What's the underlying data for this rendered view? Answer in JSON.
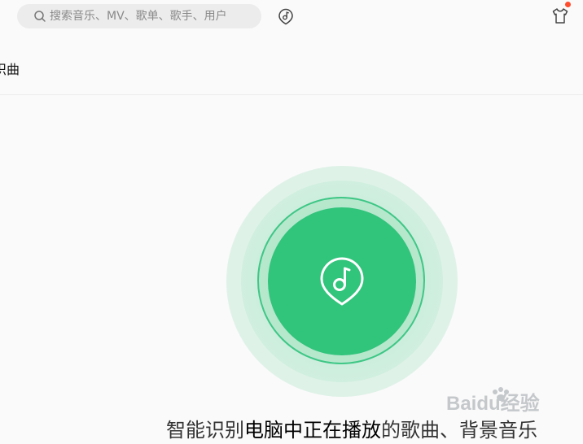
{
  "header": {
    "search_placeholder": "搜索音乐、MV、歌单、歌手、用户",
    "icons": {
      "search": "search-icon",
      "music_recognize": "music-note-icon",
      "skin": "tshirt-icon"
    },
    "has_notification": true
  },
  "tab": {
    "label": "识曲"
  },
  "recognizer": {
    "icon": "music-note-icon"
  },
  "caption": {
    "part1": "智能识别",
    "part2": "电脑中正在播放",
    "part3": "的歌曲、背景音乐"
  },
  "watermark": {
    "brand": "Baidu经验"
  },
  "colors": {
    "accent": "#31c47b",
    "ring_light": "#dff2e8",
    "notification": "#ff4d2e",
    "background": "#fafafa"
  }
}
